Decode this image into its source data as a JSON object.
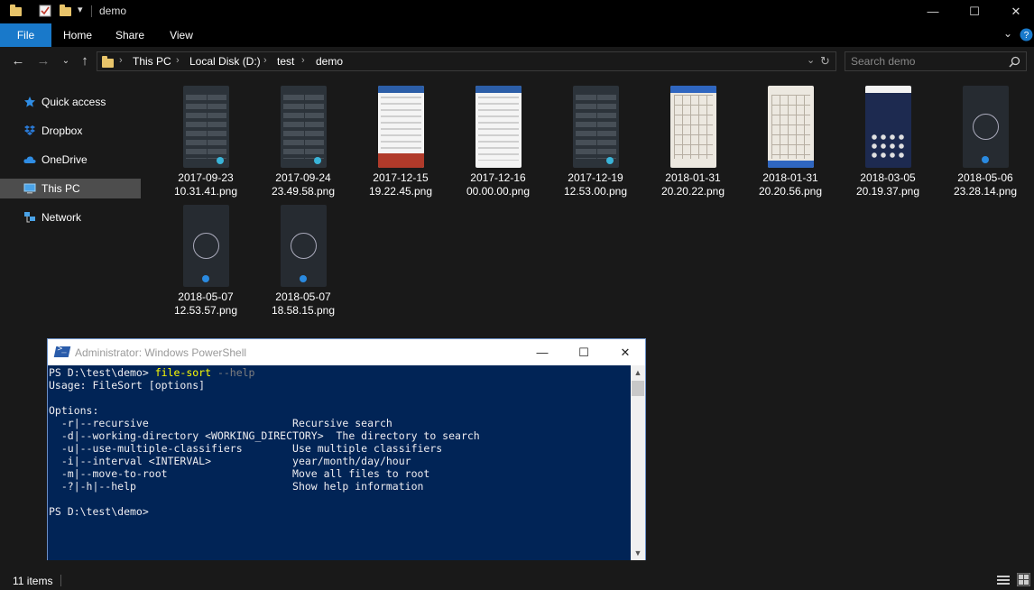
{
  "window": {
    "title": "demo"
  },
  "ribbon": {
    "tabs": [
      "File",
      "Home",
      "Share",
      "View"
    ]
  },
  "address": {
    "crumbs": [
      "This PC",
      "Local Disk (D:)",
      "test",
      "demo"
    ],
    "search_placeholder": "Search demo"
  },
  "nav": {
    "items": [
      {
        "label": "Quick access",
        "icon": "star-icon"
      },
      {
        "label": "Dropbox",
        "icon": "dropbox-icon"
      },
      {
        "label": "OneDrive",
        "icon": "cloud-icon"
      },
      {
        "label": "This PC",
        "icon": "computer-icon",
        "selected": true
      },
      {
        "label": "Network",
        "icon": "network-icon"
      }
    ]
  },
  "files": [
    {
      "line1": "2017-09-23",
      "line2": "10.31.41.png",
      "thumb": "dark"
    },
    {
      "line1": "2017-09-24",
      "line2": "23.49.58.png",
      "thumb": "dark"
    },
    {
      "line1": "2017-12-15",
      "line2": "19.22.45.png",
      "thumb": "white-red"
    },
    {
      "line1": "2017-12-16",
      "line2": "00.00.00.png",
      "thumb": "white"
    },
    {
      "line1": "2017-12-19",
      "line2": "12.53.00.png",
      "thumb": "dark"
    },
    {
      "line1": "2018-01-31",
      "line2": "20.20.22.png",
      "thumb": "plan"
    },
    {
      "line1": "2018-01-31",
      "line2": "20.20.56.png",
      "thumb": "plan"
    },
    {
      "line1": "2018-03-05",
      "line2": "20.19.37.png",
      "thumb": "phone"
    },
    {
      "line1": "2018-05-06",
      "line2": "23.28.14.png",
      "thumb": "timer"
    },
    {
      "line1": "2018-05-07",
      "line2": "12.53.57.png",
      "thumb": "timer"
    },
    {
      "line1": "2018-05-07",
      "line2": "18.58.15.png",
      "thumb": "timer"
    }
  ],
  "status": {
    "count": "11 items"
  },
  "powershell": {
    "title": "Administrator: Windows PowerShell",
    "prompt": "PS D:\\test\\demo> ",
    "command": "file-sort",
    "args": " --help",
    "output": "Usage: FileSort [options]\n\nOptions:\n  -r|--recursive                       Recursive search\n  -d|--working-directory <WORKING_DIRECTORY>  The directory to search\n  -u|--use-multiple-classifiers        Use multiple classifiers\n  -i|--interval <INTERVAL>             year/month/day/hour\n  -m|--move-to-root                    Move all files to root\n  -?|-h|--help                         Show help information\n\nPS D:\\test\\demo>"
  },
  "colors": {
    "accent": "#1979ca",
    "console_bg": "#012456",
    "command": "#ffff00"
  }
}
